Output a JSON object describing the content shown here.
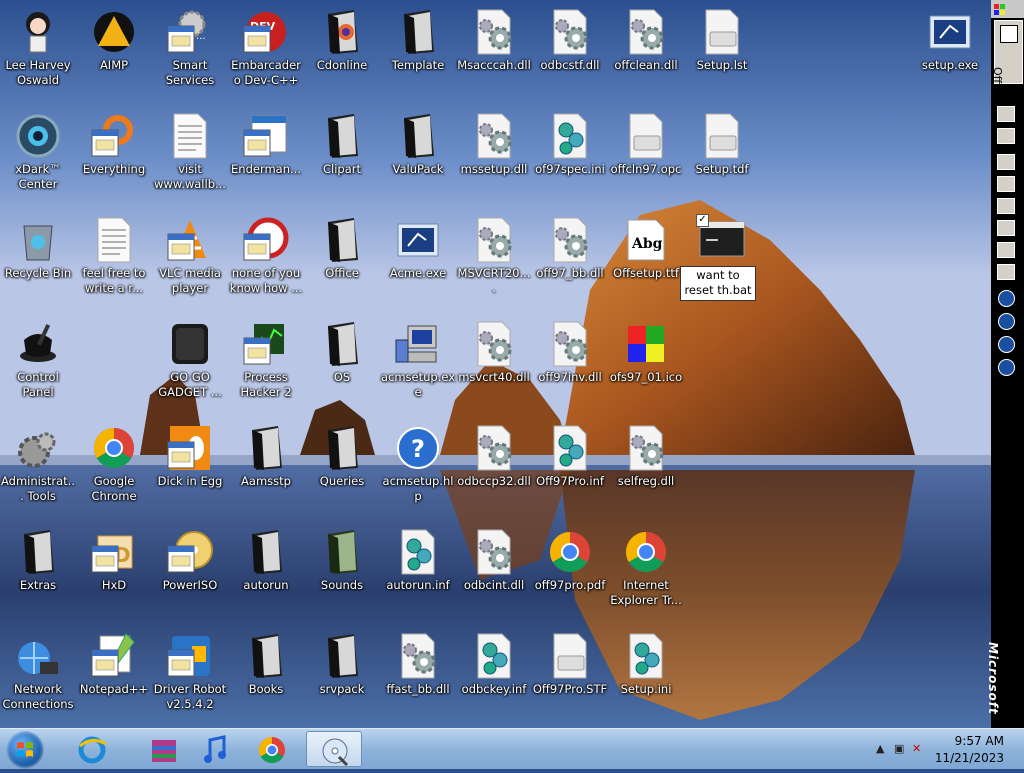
{
  "desktop": {
    "icons": [
      {
        "label": "Lee Harvey Oswald",
        "kind": "anime-avatar",
        "col": 0,
        "row": 0
      },
      {
        "label": "AIMP",
        "kind": "aimp-triangle",
        "col": 1,
        "row": 0
      },
      {
        "label": "Smart Services",
        "kind": "gear-window",
        "col": 2,
        "row": 0
      },
      {
        "label": "Embarcadero Dev-C++",
        "kind": "devcpp",
        "col": 3,
        "row": 0
      },
      {
        "label": "Cdonline",
        "kind": "folder-firefox",
        "col": 4,
        "row": 0
      },
      {
        "label": "Template",
        "kind": "folder",
        "col": 5,
        "row": 0
      },
      {
        "label": "Msacccah.dll",
        "kind": "gear-file",
        "col": 6,
        "row": 0
      },
      {
        "label": "odbcstf.dll",
        "kind": "gear-file",
        "col": 7,
        "row": 0
      },
      {
        "label": "offclean.dll",
        "kind": "gear-file",
        "col": 8,
        "row": 0
      },
      {
        "label": "Setup.lst",
        "kind": "blank-file",
        "col": 9,
        "row": 0
      },
      {
        "label": "setup.exe",
        "kind": "setup-exe",
        "col": 12,
        "row": 0
      },
      {
        "label": "xDark™ Center",
        "kind": "xdark",
        "col": 0,
        "row": 1
      },
      {
        "label": "Everything",
        "kind": "everything",
        "col": 1,
        "row": 1
      },
      {
        "label": "visit www.wallb...",
        "kind": "text-file",
        "col": 2,
        "row": 1
      },
      {
        "label": "Enderman...",
        "kind": "app-window",
        "col": 3,
        "row": 1
      },
      {
        "label": "Clipart",
        "kind": "folder",
        "col": 4,
        "row": 1
      },
      {
        "label": "ValuPack",
        "kind": "folder",
        "col": 5,
        "row": 1
      },
      {
        "label": "mssetup.dll",
        "kind": "gear-file",
        "col": 6,
        "row": 1
      },
      {
        "label": "of97spec.ini",
        "kind": "ini-file",
        "col": 7,
        "row": 1
      },
      {
        "label": "offcln97.opc",
        "kind": "blank-file",
        "col": 8,
        "row": 1
      },
      {
        "label": "Setup.tdf",
        "kind": "blank-file",
        "col": 9,
        "row": 1
      },
      {
        "label": "Recycle Bin",
        "kind": "recycle-bin",
        "col": 0,
        "row": 2
      },
      {
        "label": "feel free to write a r...",
        "kind": "text-file",
        "col": 1,
        "row": 2
      },
      {
        "label": "VLC media player",
        "kind": "vlc",
        "col": 2,
        "row": 2
      },
      {
        "label": "none of you know how ...",
        "kind": "red-circle",
        "col": 3,
        "row": 2
      },
      {
        "label": "Office",
        "kind": "folder",
        "col": 4,
        "row": 2
      },
      {
        "label": "Acme.exe",
        "kind": "setup-exe",
        "col": 5,
        "row": 2
      },
      {
        "label": "MSVCRT20....",
        "kind": "gear-file",
        "col": 6,
        "row": 2
      },
      {
        "label": "off97_bb.dll",
        "kind": "gear-file",
        "col": 7,
        "row": 2
      },
      {
        "label": "Offsetup.ttf",
        "kind": "font-file",
        "col": 8,
        "row": 2
      },
      {
        "label": "",
        "kind": "bat-window",
        "col": 9,
        "row": 2,
        "renaming": true
      },
      {
        "label": "Control Panel",
        "kind": "control-panel",
        "col": 0,
        "row": 3
      },
      {
        "label": "GO GO GADGET ...",
        "kind": "gadget",
        "col": 2,
        "row": 3
      },
      {
        "label": "Process Hacker 2",
        "kind": "process-hacker",
        "col": 3,
        "row": 3
      },
      {
        "label": "OS",
        "kind": "folder",
        "col": 4,
        "row": 3
      },
      {
        "label": "acmsetup.exe",
        "kind": "computer",
        "col": 5,
        "row": 3
      },
      {
        "label": "msvcrt40.dll",
        "kind": "gear-file",
        "col": 6,
        "row": 3
      },
      {
        "label": "off97inv.dll",
        "kind": "gear-file",
        "col": 7,
        "row": 3
      },
      {
        "label": "ofs97_01.ico",
        "kind": "puzzle",
        "col": 8,
        "row": 3
      },
      {
        "label": "Administrat... Tools",
        "kind": "admin-tools",
        "col": 0,
        "row": 4
      },
      {
        "label": "Google Chrome",
        "kind": "chrome",
        "col": 1,
        "row": 4
      },
      {
        "label": "Dick in Egg",
        "kind": "egg",
        "col": 2,
        "row": 4
      },
      {
        "label": "Aamsstp",
        "kind": "folder",
        "col": 3,
        "row": 4
      },
      {
        "label": "Queries",
        "kind": "folder",
        "col": 4,
        "row": 4
      },
      {
        "label": "acmsetup.hlp",
        "kind": "help",
        "col": 5,
        "row": 4
      },
      {
        "label": "odbccp32.dll",
        "kind": "gear-file",
        "col": 6,
        "row": 4
      },
      {
        "label": "Off97Pro.inf",
        "kind": "ini-file",
        "col": 7,
        "row": 4
      },
      {
        "label": "selfreg.dll",
        "kind": "gear-file",
        "col": 8,
        "row": 4
      },
      {
        "label": "Extras",
        "kind": "folder",
        "col": 0,
        "row": 5
      },
      {
        "label": "HxD",
        "kind": "hxd",
        "col": 1,
        "row": 5
      },
      {
        "label": "PowerISO",
        "kind": "poweriso",
        "col": 2,
        "row": 5
      },
      {
        "label": "autorun",
        "kind": "folder",
        "col": 3,
        "row": 5
      },
      {
        "label": "Sounds",
        "kind": "folder-green",
        "col": 4,
        "row": 5
      },
      {
        "label": "autorun.inf",
        "kind": "ini-file",
        "col": 5,
        "row": 5
      },
      {
        "label": "odbcint.dll",
        "kind": "gear-file",
        "col": 6,
        "row": 5
      },
      {
        "label": "off97pro.pdf",
        "kind": "chrome",
        "col": 7,
        "row": 5
      },
      {
        "label": "Internet Explorer Tr...",
        "kind": "chrome",
        "col": 8,
        "row": 5
      },
      {
        "label": "Network Connections",
        "kind": "network",
        "col": 0,
        "row": 6
      },
      {
        "label": "Notepad++",
        "kind": "notepadpp",
        "col": 1,
        "row": 6
      },
      {
        "label": "Driver Robot v2.5.4.2",
        "kind": "driver-robot",
        "col": 2,
        "row": 6
      },
      {
        "label": "Books",
        "kind": "folder",
        "col": 3,
        "row": 6
      },
      {
        "label": "srvpack",
        "kind": "folder",
        "col": 4,
        "row": 6
      },
      {
        "label": "ffast_bb.dll",
        "kind": "gear-file",
        "col": 5,
        "row": 6
      },
      {
        "label": "odbckey.inf",
        "kind": "ini-file",
        "col": 6,
        "row": 6
      },
      {
        "label": "Off97Pro.STF",
        "kind": "blank-file",
        "col": 7,
        "row": 6
      },
      {
        "label": "Setup.ini",
        "kind": "ini-file",
        "col": 8,
        "row": 6
      }
    ],
    "rename_text": "want to reset th.bat"
  },
  "office_bar": {
    "title": "Office",
    "brand": "Microsoft"
  },
  "taskbar": {
    "pinned": [
      {
        "name": "internet-explorer",
        "icon": "ie-icon"
      },
      {
        "name": "winrar",
        "icon": "archive-icon"
      },
      {
        "name": "itunes",
        "icon": "music-note-icon"
      },
      {
        "name": "chrome",
        "icon": "chrome-icon"
      },
      {
        "name": "active-window",
        "icon": "cd-tool-icon"
      }
    ],
    "clock": {
      "time": "9:57 AM",
      "date": "11/21/2023"
    }
  },
  "colors": {
    "taskbar": "#8fb4db",
    "office_bar": "#000000",
    "rock": "#b5642a",
    "sky_top": "#2a4f8c"
  }
}
